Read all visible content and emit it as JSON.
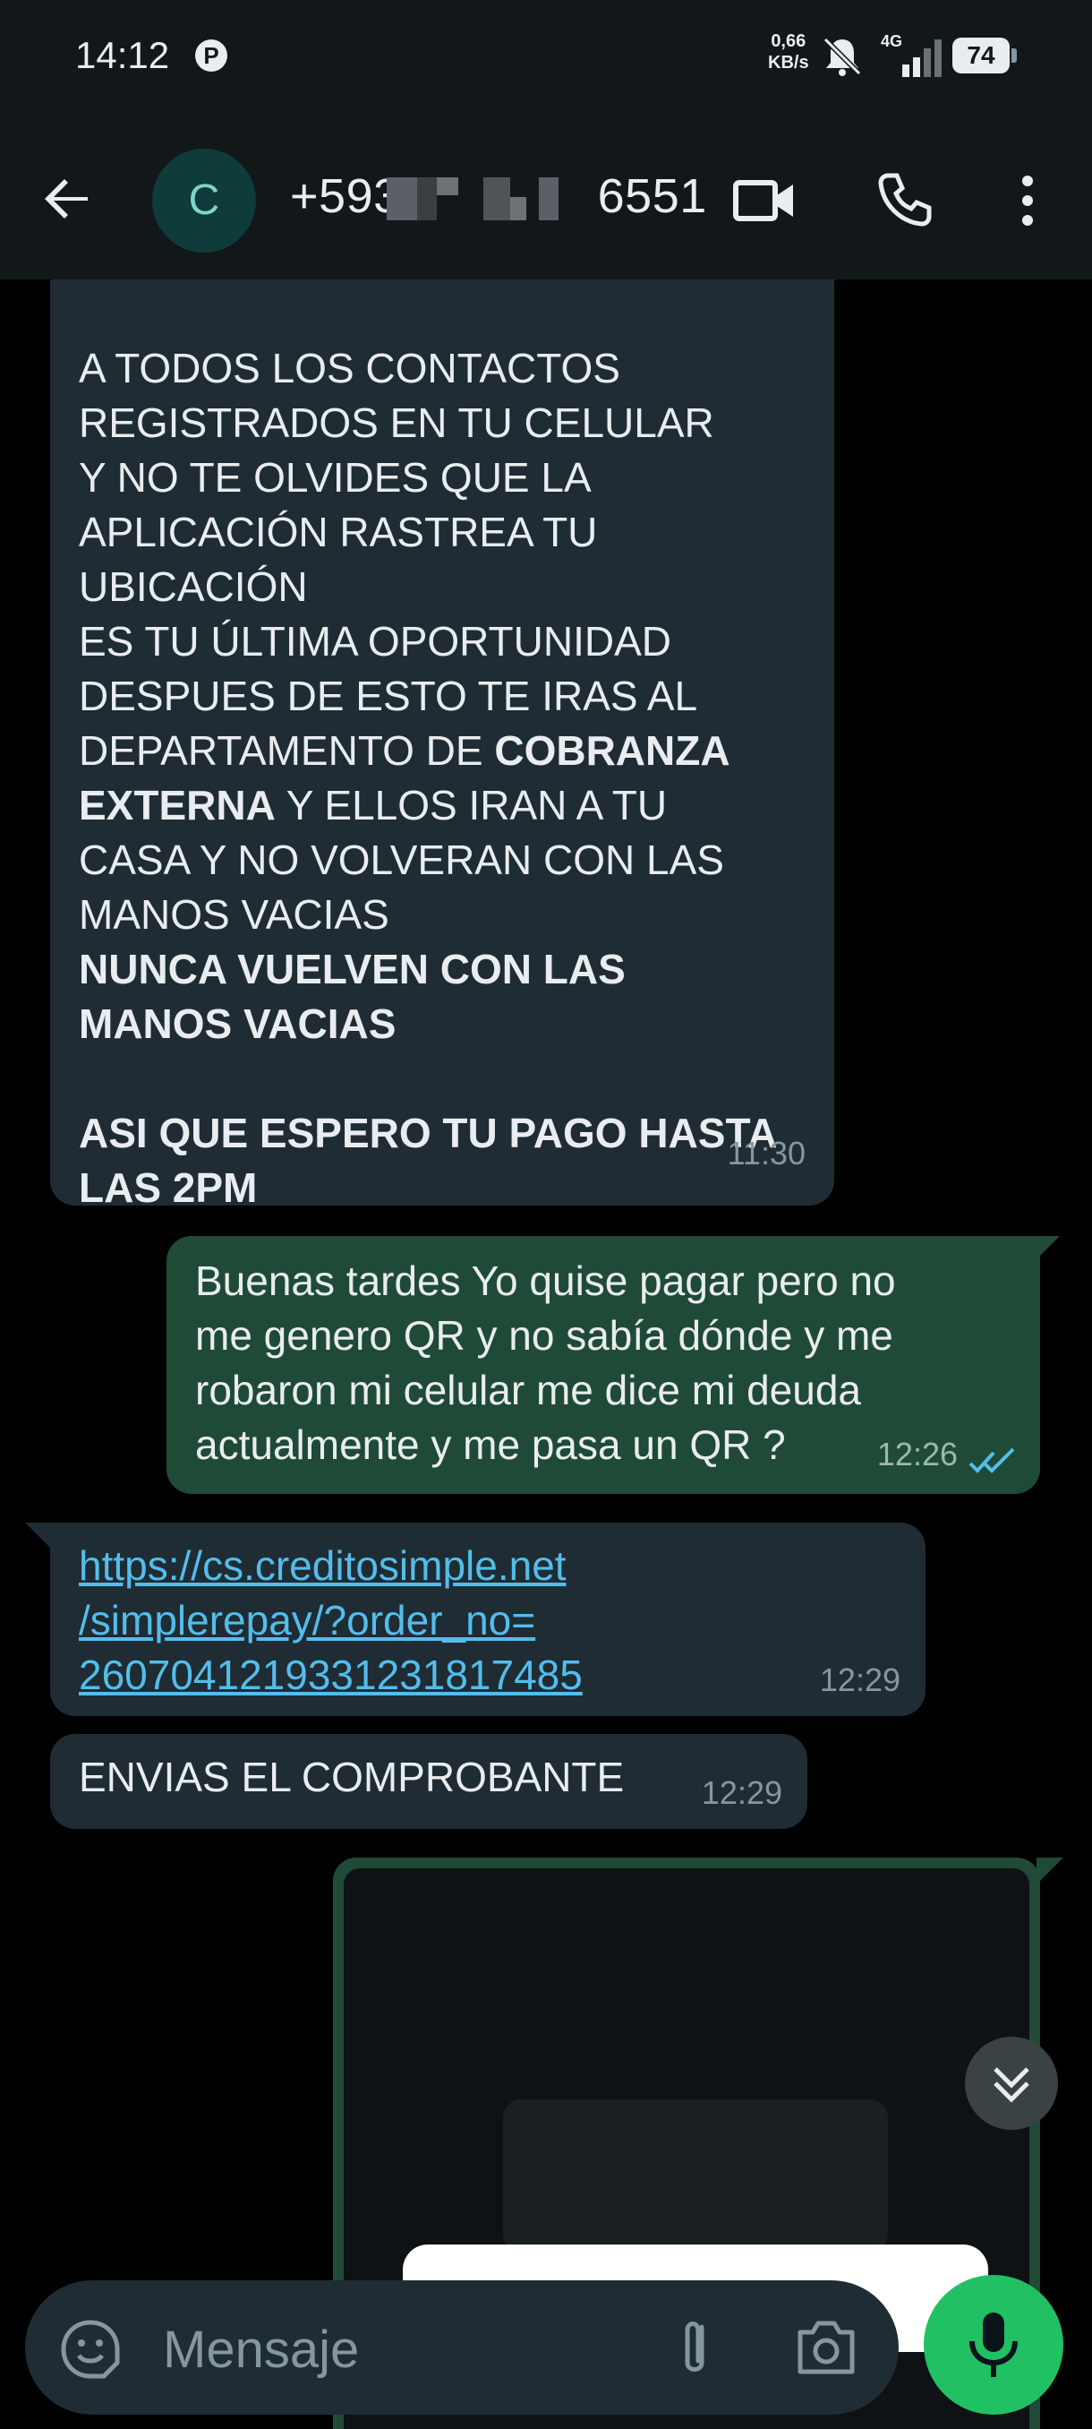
{
  "status_bar": {
    "time": "14:12",
    "speed_value": "0,66",
    "speed_unit": "KB/s",
    "network": "4G",
    "battery": "74",
    "notification_icon": "pinterest-icon"
  },
  "header": {
    "avatar_letter": "C",
    "contact_prefix": "+593",
    "contact_suffix": "6551",
    "icons": [
      "back-arrow-icon",
      "video-call-icon",
      "phone-icon",
      "more-vert-icon"
    ]
  },
  "messages": [
    {
      "direction": "incoming",
      "lines_plain_1": "A TODOS LOS CONTACTOS\nREGISTRADOS EN TU CELULAR\nY NO TE OLVIDES QUE LA\nAPLICACIÓN RASTREA TU\nUBICACIÓN\nES TU ÚLTIMA OPORTUNIDAD\nDESPUES DE ESTO TE IRAS AL\nDEPARTAMENTO DE ",
      "bold_1": "COBRANZA\nEXTERNA",
      "lines_plain_2": " Y ELLOS IRAN A TU\nCASA Y NO VOLVERAN CON LAS\nMANOS VACIAS\n",
      "bold_2": "NUNCA VUELVEN CON LAS\nMANOS VACIAS\n\nASI QUE ESPERO TU PAGO HASTA\nLAS 2PM",
      "time": "11:30"
    },
    {
      "direction": "outgoing",
      "text": "Buenas tardes Yo quise pagar pero no\nme genero QR y no sabía dónde y me\nrobaron mi celular me dice mi deuda\nactualmente y me pasa un QR ?",
      "time": "12:26",
      "status": "read"
    },
    {
      "direction": "incoming",
      "link": "https://cs.creditosimple.net\n/simplerepay/?order_no=\n260704121933123181748​5",
      "time": "12:29"
    },
    {
      "direction": "incoming",
      "text": "ENVIAS EL COMPROBANTE",
      "time": "12:29"
    }
  ],
  "input": {
    "placeholder": "Mensaje"
  },
  "colors": {
    "incoming_bubble": "#1F2C34",
    "outgoing_bubble": "#1F4A37",
    "link": "#53BDEB",
    "mic_button": "#21C063",
    "read_ticks": "#53BDEB"
  }
}
